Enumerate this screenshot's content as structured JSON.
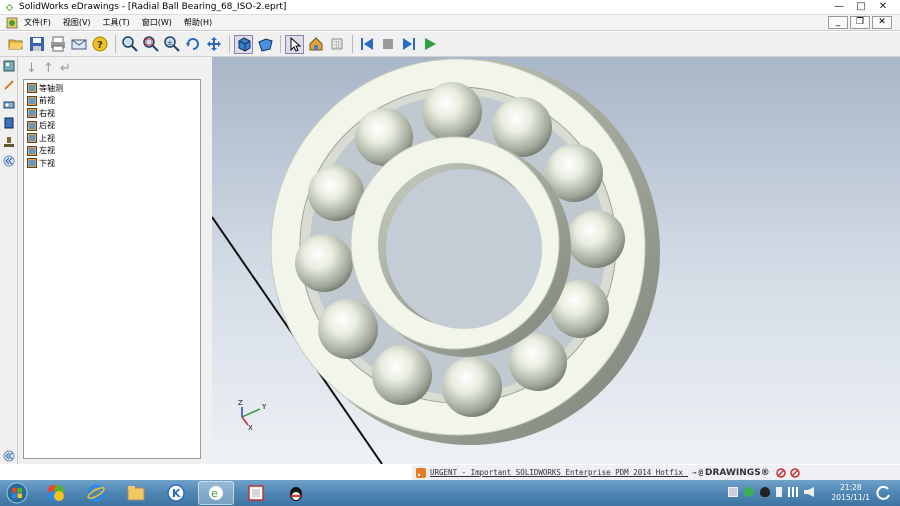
{
  "window": {
    "title": "SolidWorks eDrawings - [Radial Ball Bearing_68_ISO-2.eprt]",
    "min_label": "—",
    "max_label": "□",
    "close_label": "✕"
  },
  "menu": {
    "items": [
      "文件(F)",
      "视图(V)",
      "工具(T)",
      "窗口(W)",
      "帮助(H)"
    ],
    "mdi_min": "_",
    "mdi_restore": "❐",
    "mdi_close": "✕"
  },
  "panel": {
    "nav_down": "↓",
    "nav_up": "↑",
    "nav_return": "↵",
    "tree_items": [
      "等轴测",
      "前视",
      "右视",
      "后视",
      "上视",
      "左视",
      "下视"
    ]
  },
  "statusbar": {
    "message": "URGENT - Important SOLIDWORKS Enterprise PDM 2014 Hotfix no...",
    "brand": "DRAWINGS®",
    "brand_prefix": "@"
  },
  "taskbar": {
    "time": "21:28",
    "date": "2015/11/1"
  },
  "colors": {
    "bearing_ring": "#f1f5ea",
    "viewport_top": "#a9b6c8",
    "taskbar": "#4f86b4"
  },
  "triad_labels": {
    "z": "Z",
    "y": "Y",
    "x": "X"
  }
}
